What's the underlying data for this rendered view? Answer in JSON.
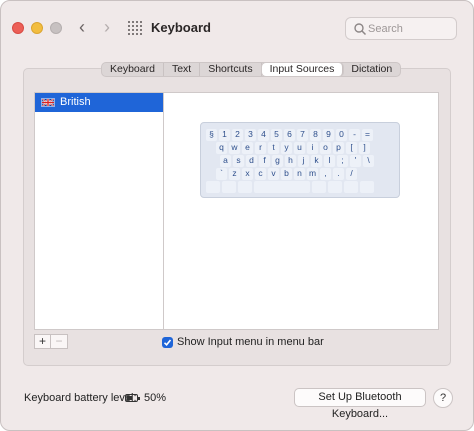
{
  "window": {
    "title": "Keyboard"
  },
  "search": {
    "placeholder": "Search"
  },
  "tabs": [
    {
      "label": "Keyboard"
    },
    {
      "label": "Text"
    },
    {
      "label": "Shortcuts"
    },
    {
      "label": "Input Sources",
      "active": true
    },
    {
      "label": "Dictation"
    }
  ],
  "sources": {
    "items": [
      {
        "label": "British",
        "icon": "uk-flag-icon",
        "selected": true
      }
    ]
  },
  "keyboard_preview": {
    "rows": [
      [
        "§",
        "1",
        "2",
        "3",
        "4",
        "5",
        "6",
        "7",
        "8",
        "9",
        "0",
        "-",
        "="
      ],
      [
        "q",
        "w",
        "e",
        "r",
        "t",
        "y",
        "u",
        "i",
        "o",
        "p",
        "[",
        "]"
      ],
      [
        "a",
        "s",
        "d",
        "f",
        "g",
        "h",
        "j",
        "k",
        "l",
        ";",
        "'",
        "\\"
      ],
      [
        "`",
        "z",
        "x",
        "c",
        "v",
        "b",
        "n",
        "m",
        ",",
        ".",
        "/"
      ]
    ]
  },
  "list_controls": {
    "add_label": "+",
    "remove_label": "−"
  },
  "show_input_menu": {
    "label": "Show Input menu in menu bar",
    "checked": true
  },
  "battery": {
    "label": "Keyboard battery level:",
    "value": "50%"
  },
  "bluetooth_button": {
    "label": "Set Up Bluetooth Keyboard..."
  },
  "help": {
    "label": "?"
  },
  "colors": {
    "accent": "#1f65d8"
  }
}
